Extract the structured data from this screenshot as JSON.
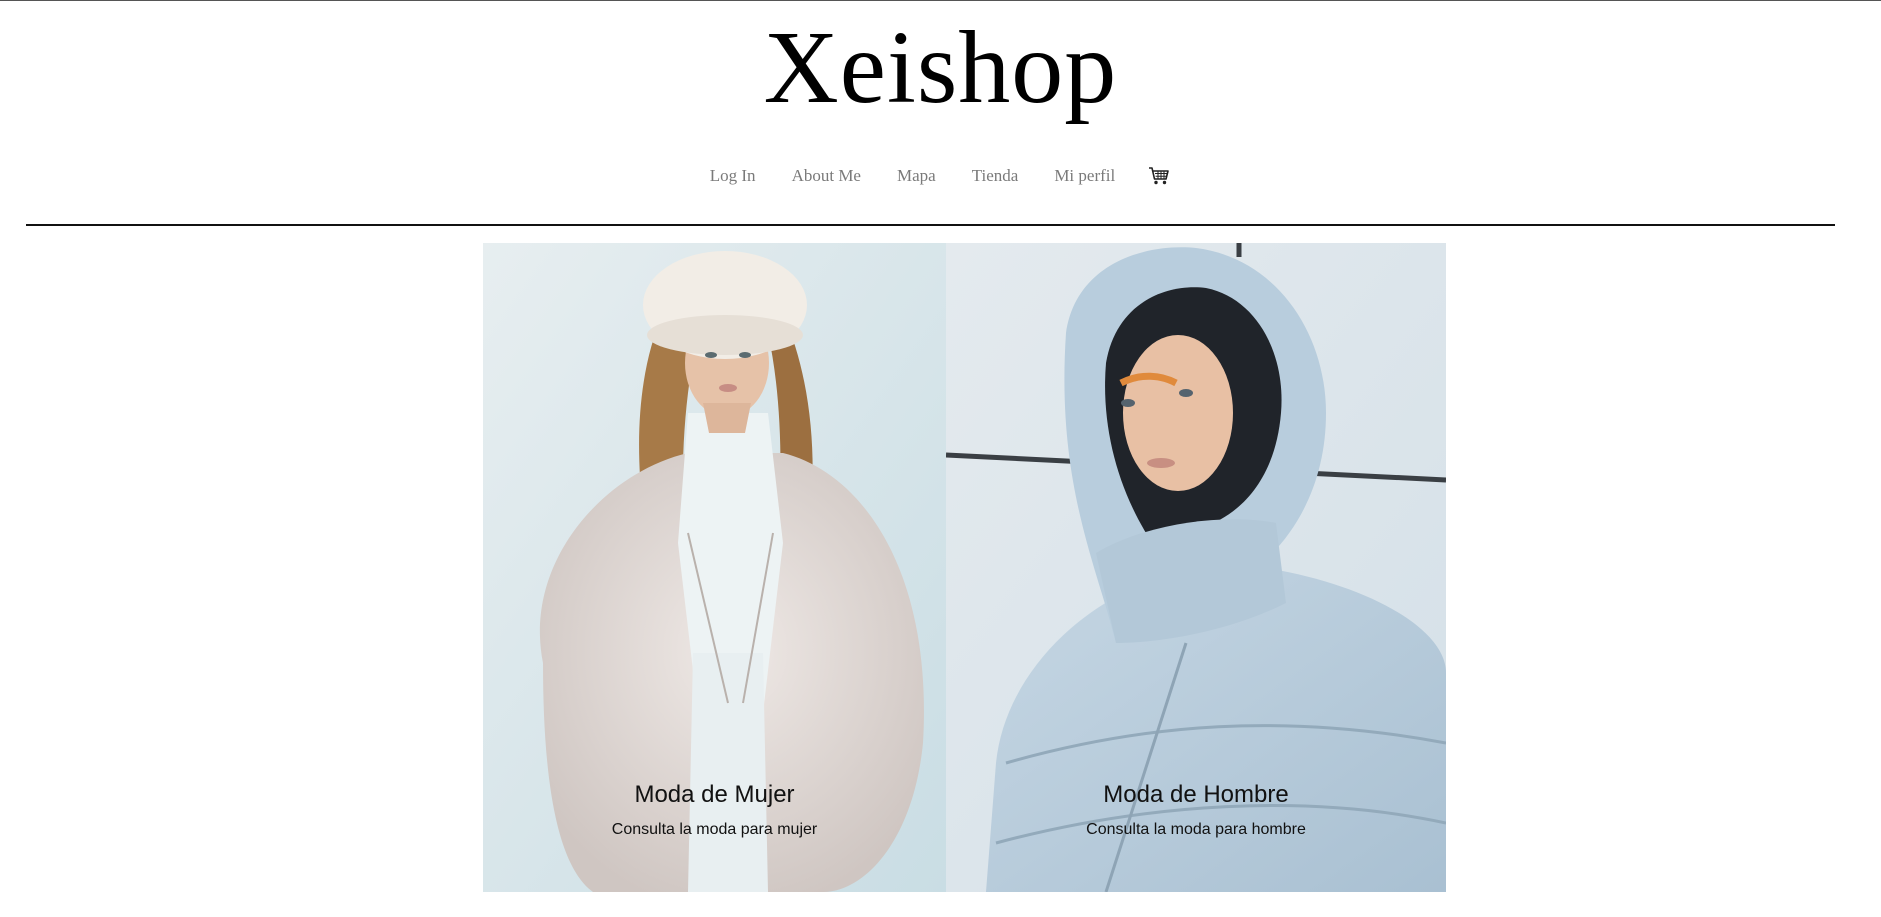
{
  "header": {
    "brand": "Xeishop"
  },
  "nav": {
    "items": [
      {
        "label": "Log In"
      },
      {
        "label": "About Me"
      },
      {
        "label": "Mapa"
      },
      {
        "label": "Tienda"
      },
      {
        "label": "Mi perfil"
      }
    ],
    "cart_icon": "shopping-cart-icon"
  },
  "gallery": {
    "women": {
      "title": "Moda de Mujer",
      "subtitle": "Consulta la moda para mujer"
    },
    "men": {
      "title": "Moda de Hombre",
      "subtitle": "Consulta la moda para hombre"
    }
  },
  "colors": {
    "nav_link": "#7a7a7a",
    "text": "#111111",
    "divider": "#111111",
    "background": "#ffffff"
  }
}
